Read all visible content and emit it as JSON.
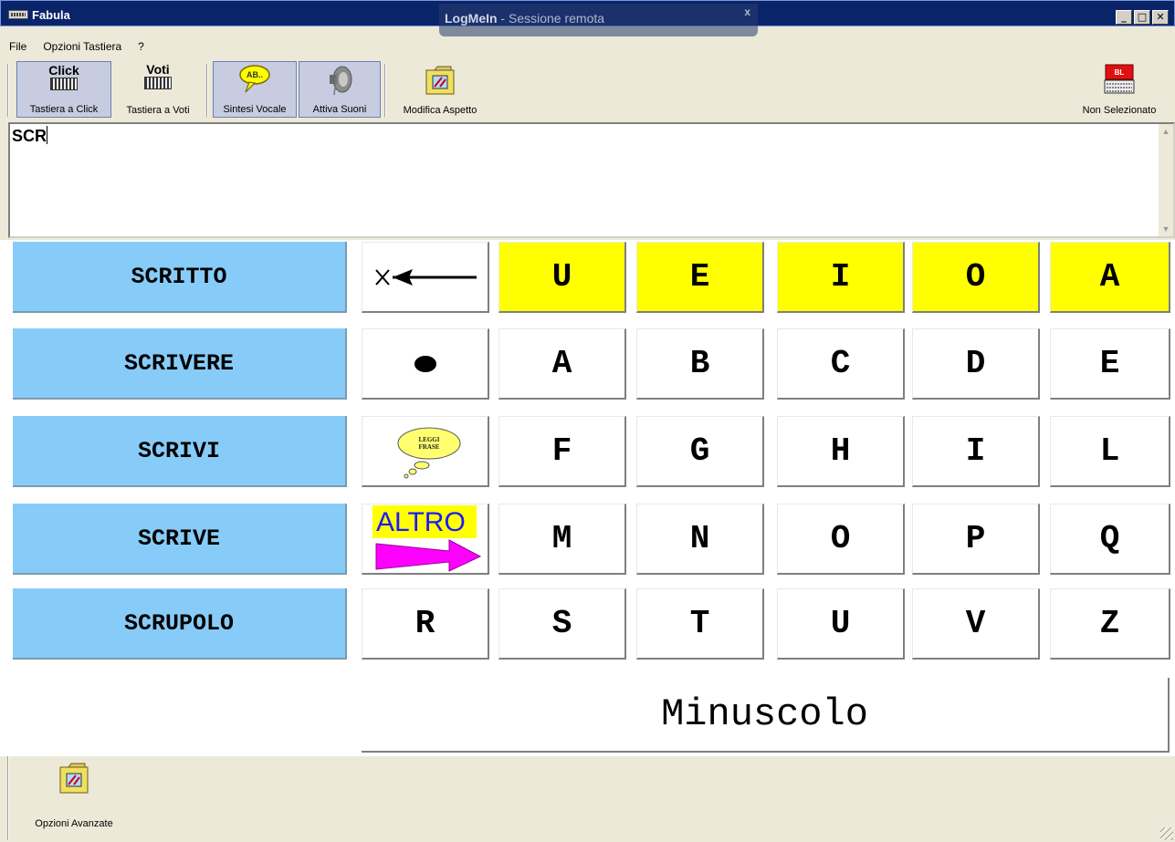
{
  "window": {
    "title": "Fabula",
    "minimize": "_",
    "maximize": "□",
    "close": "✕"
  },
  "overlay": {
    "brand": "LogMeIn",
    "separator": " - ",
    "subtitle": "Sessione remota",
    "close": "x"
  },
  "menu": {
    "items": [
      "File",
      "Opzioni Tastiera",
      "?"
    ]
  },
  "toolbar": {
    "click_top": "Click",
    "click_label": "Tastiera a Click",
    "voti_top": "Voti",
    "voti_label": "Tastiera a Voti",
    "speech_icon_text": "AB..",
    "speech_label": "Sintesi Vocale",
    "sound_label": "Attiva Suoni",
    "appearance_label": "Modifica Aspetto",
    "status_icon_text": "BL",
    "status_label": "Non Selezionato"
  },
  "text_area": {
    "value": "SCR"
  },
  "suggestions": [
    "SCRITTO",
    "SCRIVERE",
    "SCRIVI",
    "SCRIVE",
    "SCRUPOLO"
  ],
  "keys": {
    "vowel_row": [
      "U",
      "E",
      "I",
      "O",
      "A"
    ],
    "row1": [
      "A",
      "B",
      "C",
      "D",
      "E"
    ],
    "row2": [
      "F",
      "G",
      "H",
      "I",
      "L"
    ],
    "row3": [
      "M",
      "N",
      "O",
      "P",
      "Q"
    ],
    "row4": [
      "R",
      "S",
      "T",
      "U",
      "V",
      "Z"
    ],
    "read_phrase_line1": "LEGGI",
    "read_phrase_line2": "FRASE",
    "other_label": "ALTRO",
    "case_toggle": "Minuscolo"
  },
  "colors": {
    "suggestion_bg": "#87ccf8",
    "vowel_bg": "#ffff00",
    "titlebar": "#0a246a",
    "arrow": "#ff00ff"
  },
  "icons": [
    "keyboard-icon",
    "speech-bubble-icon",
    "speaker-icon",
    "tools-folder-icon",
    "keyboard-status-icon",
    "backspace-arrow-icon",
    "dot-icon",
    "thought-bubble-icon",
    "right-arrow-icon"
  ],
  "bottom": {
    "advanced_label": "Opzioni Avanzate"
  }
}
